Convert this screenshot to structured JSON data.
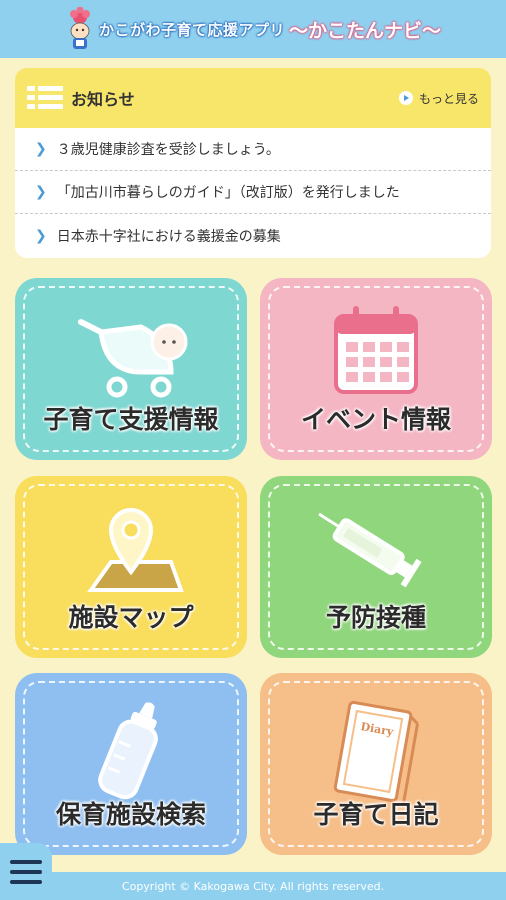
{
  "header": {
    "title": "かこがわ子育て応援アプリ",
    "subtitle": "〜かこたんナビ〜"
  },
  "news": {
    "title": "お知らせ",
    "more_label": "もっと見る",
    "items": [
      {
        "text": "３歳児健康診査を受診しましょう。"
      },
      {
        "text": "「加古川市暮らしのガイド」（改訂版）を発行しました"
      },
      {
        "text": "日本赤十字社における義援金の募集"
      }
    ]
  },
  "tiles": [
    {
      "label": "子育て支援情報",
      "icon": "baby-stroller-icon",
      "color": "#7fd7d2"
    },
    {
      "label": "イベント情報",
      "icon": "calendar-icon",
      "color": "#f5b6c4"
    },
    {
      "label": "施設マップ",
      "icon": "map-pin-icon",
      "color": "#f9dd5c"
    },
    {
      "label": "予防接種",
      "icon": "syringe-icon",
      "color": "#8fd67c"
    },
    {
      "label": "保育施設検索",
      "icon": "baby-bottle-icon",
      "color": "#8fbff0"
    },
    {
      "label": "子育て日記",
      "icon": "diary-icon",
      "color": "#f6bf8a"
    }
  ],
  "diary_cover_text": "Diary",
  "footer": {
    "copyright": "Copyright © Kakogawa City. All rights reserved."
  },
  "colors": {
    "header_bg": "#8fd0ef",
    "page_bg": "#fbf3c8",
    "news_head_bg": "#f8e66b"
  }
}
